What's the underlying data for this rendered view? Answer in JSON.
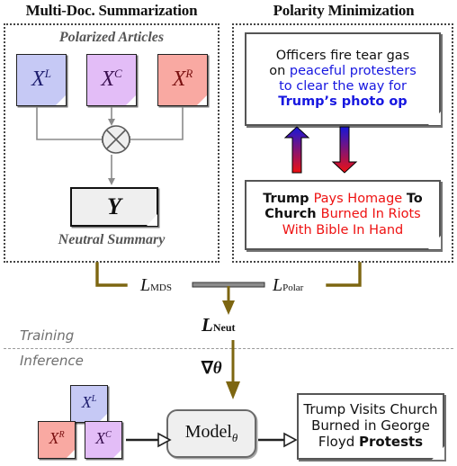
{
  "panels": {
    "left": {
      "title": "Multi-Doc. Summarization",
      "caption_top": "Polarized Articles",
      "caption_bottom": "Neutral Summary",
      "output_symbol": "Y"
    },
    "right": {
      "title": "Polarity Minimization"
    }
  },
  "documents": {
    "left_note": {
      "label": "X",
      "sup": "L",
      "color": "#c6c9f5",
      "text_color": "#1d1d6e"
    },
    "center_note": {
      "label": "X",
      "sup": "C",
      "color": "#e3bdf7",
      "text_color": "#3a1050"
    },
    "right_note": {
      "label": "X",
      "sup": "R",
      "color": "#f9a9a2",
      "text_color": "#7a1010"
    }
  },
  "headline_top": {
    "lines": [
      [
        {
          "t": "Officers fire tear gas",
          "style": "blk"
        }
      ],
      [
        {
          "t": "on ",
          "style": "blk"
        },
        {
          "t": "peaceful protesters",
          "style": "blue"
        }
      ],
      [
        {
          "t": "to clear the way for",
          "style": "blue"
        }
      ],
      [
        {
          "t": "Trump’s photo op",
          "style": "blue-b"
        }
      ]
    ]
  },
  "headline_bottom": {
    "lines": [
      [
        {
          "t": "Trump ",
          "style": "blk-b"
        },
        {
          "t": "Pays Homage ",
          "style": "red"
        },
        {
          "t": "To",
          "style": "blk-b"
        }
      ],
      [
        {
          "t": "Church ",
          "style": "blk-b"
        },
        {
          "t": "Burned In Riots",
          "style": "red"
        }
      ],
      [
        {
          "t": "With Bible In Hand",
          "style": "red"
        }
      ]
    ]
  },
  "losses": {
    "mds": {
      "symbol": "L",
      "sub": "MDS"
    },
    "polar": {
      "symbol": "L",
      "sub": "Polar"
    },
    "neut": {
      "symbol": "L",
      "sub": "Neut"
    }
  },
  "gradient_label": {
    "nabla": "∇",
    "theta": "θ"
  },
  "stages": {
    "training": "Training",
    "inference": "Inference"
  },
  "model": {
    "name": "Model",
    "subscript": "θ"
  },
  "inference_notes": {
    "left": {
      "label": "X",
      "sup": "L",
      "color": "#c6c9f5",
      "text_color": "#1d1d6e"
    },
    "right": {
      "label": "X",
      "sup": "R",
      "color": "#f9a9a2",
      "text_color": "#7a1010"
    },
    "center": {
      "label": "X",
      "sup": "C",
      "color": "#e3bdf7",
      "text_color": "#3a1050"
    }
  },
  "output_headline": {
    "lines": [
      [
        {
          "t": "Trump Visits Church",
          "style": "blk"
        }
      ],
      [
        {
          "t": "Burned in George",
          "style": "blk"
        }
      ],
      [
        {
          "t": "Floyd ",
          "style": "blk"
        },
        {
          "t": "Protests",
          "style": "blk-b"
        }
      ]
    ]
  },
  "colors": {
    "olive": "#7d6611",
    "blue": "#1717e0",
    "red": "#ee1111",
    "grey_line": "#8a8a8a"
  }
}
